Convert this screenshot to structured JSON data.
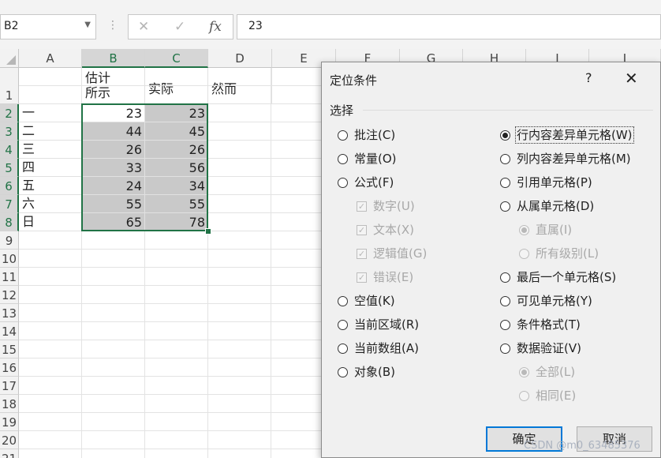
{
  "formula_bar": {
    "name_box": "B2",
    "dots": "⋮",
    "cancel_icon": "✕",
    "enter_icon": "✓",
    "fx_label": "fx",
    "value": "23"
  },
  "sheet": {
    "columns": [
      "A",
      "B",
      "C",
      "D",
      "E",
      "F",
      "G",
      "H",
      "I",
      "J"
    ],
    "rows": [
      "1",
      "2",
      "3",
      "4",
      "5",
      "6",
      "7",
      "8",
      "9",
      "10",
      "11",
      "12",
      "13",
      "14",
      "15",
      "16",
      "17",
      "18",
      "19",
      "20",
      "21"
    ],
    "header_row": {
      "b_line1": "估计",
      "b_line2": "所示",
      "c": "实际",
      "d": "然而"
    },
    "data": [
      {
        "a": "一",
        "b": "23",
        "c": "23"
      },
      {
        "a": "二",
        "b": "44",
        "c": "45"
      },
      {
        "a": "三",
        "b": "26",
        "c": "26"
      },
      {
        "a": "四",
        "b": "33",
        "c": "56"
      },
      {
        "a": "五",
        "b": "24",
        "c": "34"
      },
      {
        "a": "六",
        "b": "55",
        "c": "55"
      },
      {
        "a": "日",
        "b": "65",
        "c": "78"
      }
    ],
    "selection_color": "#217346"
  },
  "dialog": {
    "title": "定位条件",
    "help": "?",
    "close": "✕",
    "section": "选择",
    "left_options": [
      {
        "label": "批注(C)",
        "kind": "radio",
        "checked": false,
        "disabled": false
      },
      {
        "label": "常量(O)",
        "kind": "radio",
        "checked": false,
        "disabled": false
      },
      {
        "label": "公式(F)",
        "kind": "radio",
        "checked": false,
        "disabled": false
      },
      {
        "label": "数字(U)",
        "kind": "check",
        "checked": true,
        "disabled": true
      },
      {
        "label": "文本(X)",
        "kind": "check",
        "checked": true,
        "disabled": true
      },
      {
        "label": "逻辑值(G)",
        "kind": "check",
        "checked": true,
        "disabled": true
      },
      {
        "label": "错误(E)",
        "kind": "check",
        "checked": true,
        "disabled": true
      },
      {
        "label": "空值(K)",
        "kind": "radio",
        "checked": false,
        "disabled": false
      },
      {
        "label": "当前区域(R)",
        "kind": "radio",
        "checked": false,
        "disabled": false
      },
      {
        "label": "当前数组(A)",
        "kind": "radio",
        "checked": false,
        "disabled": false
      },
      {
        "label": "对象(B)",
        "kind": "radio",
        "checked": false,
        "disabled": false
      }
    ],
    "right_options": [
      {
        "label": "行内容差异单元格(W)",
        "kind": "radio",
        "checked": true,
        "disabled": false
      },
      {
        "label": "列内容差异单元格(M)",
        "kind": "radio",
        "checked": false,
        "disabled": false
      },
      {
        "label": "引用单元格(P)",
        "kind": "radio",
        "checked": false,
        "disabled": false
      },
      {
        "label": "从属单元格(D)",
        "kind": "radio",
        "checked": false,
        "disabled": false
      },
      {
        "label": "直属(I)",
        "kind": "radio",
        "checked": true,
        "disabled": true
      },
      {
        "label": "所有级别(L)",
        "kind": "radio",
        "checked": false,
        "disabled": true
      },
      {
        "label": "最后一个单元格(S)",
        "kind": "radio",
        "checked": false,
        "disabled": false
      },
      {
        "label": "可见单元格(Y)",
        "kind": "radio",
        "checked": false,
        "disabled": false
      },
      {
        "label": "条件格式(T)",
        "kind": "radio",
        "checked": false,
        "disabled": false
      },
      {
        "label": "数据验证(V)",
        "kind": "radio",
        "checked": false,
        "disabled": false
      },
      {
        "label": "全部(L)",
        "kind": "radio",
        "checked": true,
        "disabled": true
      },
      {
        "label": "相同(E)",
        "kind": "radio",
        "checked": false,
        "disabled": true
      }
    ],
    "ok": "确定",
    "cancel": "取消"
  },
  "watermark": "CSDN @m0_63485376"
}
